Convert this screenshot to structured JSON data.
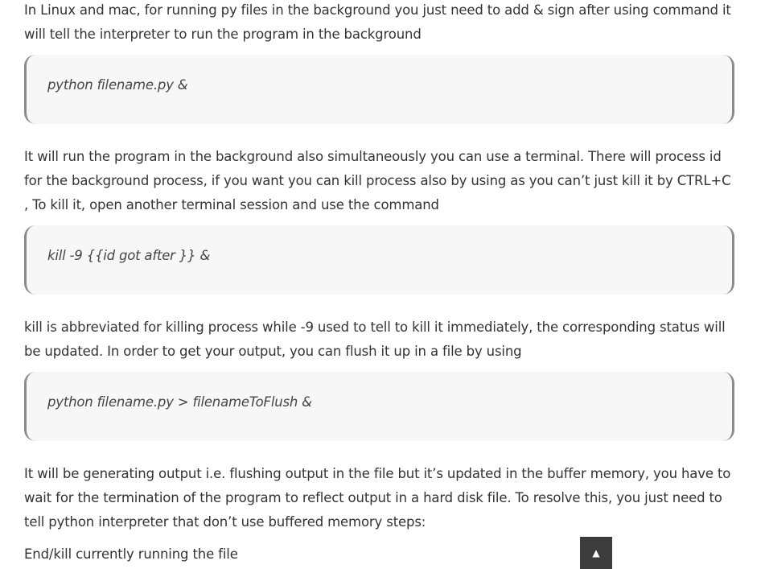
{
  "article": {
    "para1": "In Linux and mac, for running py files in the background you just need to add & sign after using command it will tell the interpreter to run the program in the background",
    "code1": "python filename.py &",
    "para2": "It will run the program in the background also simultaneously you can use a terminal. There will process id for the background process, if you want you can kill process also by using as you can’t just kill it by CTRL+C , To kill it, open another terminal session and use the command",
    "code2": "kill -9 {{id got after }} &",
    "para3": "kill is abbreviated for killing process while -9 used to tell to kill it immediately, the corresponding status will be updated. In order to get your output, you can flush it up in a file  by using",
    "code3": "python filename.py > filenameToFlush &",
    "para4": "It will be generating output i.e. flushing output in the file but it’s updated in the buffer memory, you have to wait for the termination of the program to reflect output in a hard disk file. To resolve this, you just need to tell python interpreter that don’t use buffered memory steps:",
    "para5": "End/kill currently running the file"
  },
  "scroll_top": {
    "icon": "caret-up-icon",
    "glyph": "▲"
  }
}
